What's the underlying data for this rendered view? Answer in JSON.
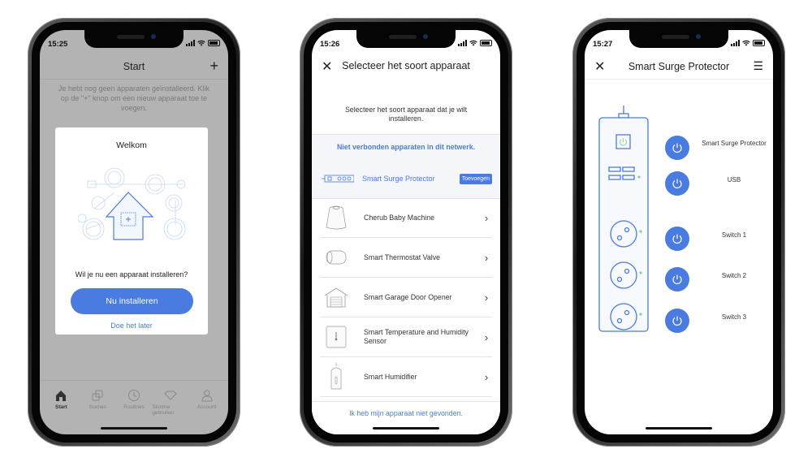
{
  "colors": {
    "accent": "#4a7be0",
    "led_green": "#7bd88f",
    "overlay_gray": "#b3b3b3"
  },
  "phone1": {
    "status_time": "15:25",
    "nav": {
      "title": "Start",
      "right_icon": "plus-icon"
    },
    "empty_message": "Je hebt nog geen apparaten geïnstalleerd. Klik op de \"+\" knop om een nieuw apparaat toe te voegen.",
    "modal": {
      "title": "Welkom",
      "question": "Wil je nu een apparaat installeren?",
      "primary_button": "Nu installeren",
      "secondary_link": "Doe het later"
    },
    "tabs": [
      {
        "label": "Start",
        "icon": "home-icon",
        "active": true
      },
      {
        "label": "Scenes",
        "icon": "scenes-icon",
        "active": false
      },
      {
        "label": "Routines",
        "icon": "clock-icon",
        "active": false
      },
      {
        "label": "Slimme gebruiker",
        "icon": "diamond-icon",
        "active": false
      },
      {
        "label": "Account",
        "icon": "user-icon",
        "active": false
      }
    ]
  },
  "phone2": {
    "status_time": "15:26",
    "nav": {
      "title": "Selecteer het soort apparaat",
      "left_icon": "close-icon"
    },
    "intro": "Selecteer het soort apparaat dat je wilt installeren.",
    "section_title": "Niet verbonden apparaten in dit netwerk.",
    "found_device": {
      "name": "Smart Surge Protector",
      "button": "Toevoegen"
    },
    "devices": [
      {
        "name": "Cherub Baby Machine",
        "icon": "baby-machine-icon"
      },
      {
        "name": "Smart Thermostat Valve",
        "icon": "thermostat-valve-icon"
      },
      {
        "name": "Smart Garage Door Opener",
        "icon": "garage-icon"
      },
      {
        "name": "Smart Temperature and Humidity Sensor",
        "icon": "sensor-icon"
      },
      {
        "name": "Smart Humidifier",
        "icon": "humidifier-icon"
      }
    ],
    "footer_link": "Ik heb mijn apparaat niet gevonden."
  },
  "phone3": {
    "status_time": "15:27",
    "nav": {
      "title": "Smart Surge Protector",
      "left_icon": "close-icon",
      "right_icon": "menu-icon"
    },
    "controls": [
      {
        "label": "Smart Surge Protector",
        "state": "on"
      },
      {
        "label": "USB",
        "state": "on"
      },
      {
        "label": "Switch 1",
        "state": "on"
      },
      {
        "label": "Switch 2",
        "state": "on"
      },
      {
        "label": "Switch 3",
        "state": "on"
      }
    ]
  }
}
